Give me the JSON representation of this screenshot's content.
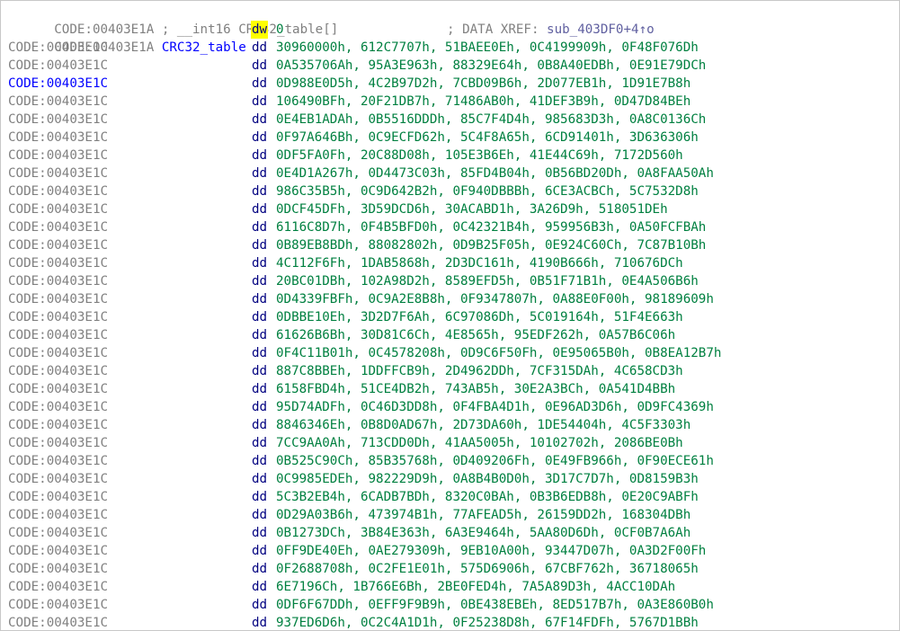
{
  "header": {
    "address": "CODE:00403E1A",
    "comment": "; __int16 CRC32_table[]"
  },
  "label_line": {
    "address": "CODE:00403E1A",
    "label": "CRC32_table",
    "mnemonic": "dw",
    "operand": "0",
    "xref_prefix": "; DATA XREF: ",
    "xref_target": "sub_403DF0+4↑o"
  },
  "rows": [
    {
      "address": "CODE:00403E1C",
      "mnemonic": "dd",
      "operands": "30960000h, 612C7707h, 51BAEE0Eh, 0C4199909h, 0F48F076Dh"
    },
    {
      "address": "CODE:00403E1C",
      "mnemonic": "dd",
      "operands": "0A535706Ah, 95A3E963h, 88329E64h, 0B8A40EDBh, 0E91E79DCh"
    },
    {
      "address": "CODE:00403E1C",
      "mnemonic": "dd",
      "operands": "0D988E0D5h, 4C2B97D2h, 7CBD09B6h, 2D077EB1h, 1D91E7B8h"
    },
    {
      "address": "CODE:00403E1C",
      "mnemonic": "dd",
      "operands": "106490BFh, 20F21DB7h, 71486AB0h, 41DEF3B9h, 0D47D84BEh"
    },
    {
      "address": "CODE:00403E1C",
      "mnemonic": "dd",
      "operands": "0E4EB1ADAh, 0B5516DDDh, 85C7F4D4h, 985683D3h, 0A8C0136Ch"
    },
    {
      "address": "CODE:00403E1C",
      "mnemonic": "dd",
      "operands": "0F97A646Bh, 0C9ECFD62h, 5C4F8A65h, 6CD91401h, 3D636306h"
    },
    {
      "address": "CODE:00403E1C",
      "mnemonic": "dd",
      "operands": "0DF5FA0Fh, 20C88D08h, 105E3B6Eh, 41E44C69h, 7172D560h"
    },
    {
      "address": "CODE:00403E1C",
      "mnemonic": "dd",
      "operands": "0E4D1A267h, 0D4473C03h, 85FD4B04h, 0B56BD20Dh, 0A8FAA50Ah"
    },
    {
      "address": "CODE:00403E1C",
      "mnemonic": "dd",
      "operands": "986C35B5h, 0C9D642B2h, 0F940DBBBh, 6CE3ACBCh, 5C7532D8h"
    },
    {
      "address": "CODE:00403E1C",
      "mnemonic": "dd",
      "operands": "0DCF45DFh, 3D59DCD6h, 30ACABD1h, 3A26D9h, 518051DEh"
    },
    {
      "address": "CODE:00403E1C",
      "mnemonic": "dd",
      "operands": "6116C8D7h, 0F4B5BFD0h, 0C42321B4h, 959956B3h, 0A50FCFBAh"
    },
    {
      "address": "CODE:00403E1C",
      "mnemonic": "dd",
      "operands": "0B89EB8BDh, 88082802h, 0D9B25F05h, 0E924C60Ch, 7C87B10Bh"
    },
    {
      "address": "CODE:00403E1C",
      "mnemonic": "dd",
      "operands": "4C112F6Fh, 1DAB5868h, 2D3DC161h, 4190B666h, 710676DCh"
    },
    {
      "address": "CODE:00403E1C",
      "mnemonic": "dd",
      "operands": "20BC01DBh, 102A98D2h, 8589EFD5h, 0B51F71B1h, 0E4A506B6h"
    },
    {
      "address": "CODE:00403E1C",
      "mnemonic": "dd",
      "operands": "0D4339FBFh, 0C9A2E8B8h, 0F9347807h, 0A88E0F00h, 98189609h"
    },
    {
      "address": "CODE:00403E1C",
      "mnemonic": "dd",
      "operands": "0DBBE10Eh, 3D2D7F6Ah, 6C97086Dh, 5C019164h, 51F4E663h"
    },
    {
      "address": "CODE:00403E1C",
      "mnemonic": "dd",
      "operands": "61626B6Bh, 30D81C6Ch, 4E8565h, 95EDF262h, 0A57B6C06h"
    },
    {
      "address": "CODE:00403E1C",
      "mnemonic": "dd",
      "operands": "0F4C11B01h, 0C4578208h, 0D9C6F50Fh, 0E95065B0h, 0B8EA12B7h"
    },
    {
      "address": "CODE:00403E1C",
      "mnemonic": "dd",
      "operands": "887C8BBEh, 1DDFFCB9h, 2D4962DDh, 7CF315DAh, 4C658CD3h"
    },
    {
      "address": "CODE:00403E1C",
      "mnemonic": "dd",
      "operands": "6158FBD4h, 51CE4DB2h, 743AB5h, 30E2A3BCh, 0A541D4BBh"
    },
    {
      "address": "CODE:00403E1C",
      "mnemonic": "dd",
      "operands": "95D74ADFh, 0C46D3DD8h, 0F4FBA4D1h, 0E96AD3D6h, 0D9FC4369h"
    },
    {
      "address": "CODE:00403E1C",
      "mnemonic": "dd",
      "operands": "8846346Eh, 0B8D0AD67h, 2D73DA60h, 1DE54404h, 4C5F3303h"
    },
    {
      "address": "CODE:00403E1C",
      "mnemonic": "dd",
      "operands": "7CC9AA0Ah, 713CDD0Dh, 41AA5005h, 10102702h, 2086BE0Bh"
    },
    {
      "address": "CODE:00403E1C",
      "mnemonic": "dd",
      "operands": "0B525C90Ch, 85B35768h, 0D409206Fh, 0E49FB966h, 0F90ECE61h"
    },
    {
      "address": "CODE:00403E1C",
      "mnemonic": "dd",
      "operands": "0C9985EDEh, 982229D9h, 0A8B4B0D0h, 3D17C7D7h, 0D8159B3h"
    },
    {
      "address": "CODE:00403E1C",
      "mnemonic": "dd",
      "operands": "5C3B2EB4h, 6CADB7BDh, 8320C0BAh, 0B3B6EDB8h, 0E20C9ABFh"
    },
    {
      "address": "CODE:00403E1C",
      "mnemonic": "dd",
      "operands": "0D29A03B6h, 473974B1h, 77AFEAD5h, 26159DD2h, 168304DBh"
    },
    {
      "address": "CODE:00403E1C",
      "mnemonic": "dd",
      "operands": "0B1273DCh, 3B84E363h, 6A3E9464h, 5AA80D6Dh, 0CF0B7A6Ah"
    },
    {
      "address": "CODE:00403E1C",
      "mnemonic": "dd",
      "operands": "0FF9DE40Eh, 0AE279309h, 9EB10A00h, 93447D07h, 0A3D2F00Fh"
    },
    {
      "address": "CODE:00403E1C",
      "mnemonic": "dd",
      "operands": "0F2688708h, 0C2FE1E01h, 575D6906h, 67CBF762h, 36718065h"
    },
    {
      "address": "CODE:00403E1C",
      "mnemonic": "dd",
      "operands": "6E7196Ch, 1B766E6Bh, 2BE0FED4h, 7A5A89D3h, 4ACC10DAh"
    },
    {
      "address": "CODE:00403E1C",
      "mnemonic": "dd",
      "operands": "0DF6F67DDh, 0EFF9F9B9h, 0BE438EBEh, 8ED517B7h, 0A3E860B0h"
    },
    {
      "address": "CODE:00403E1C",
      "mnemonic": "dd",
      "operands": "937ED6D6h, 0C2C4A1D1h, 0F25238D8h, 67F14FDFh, 5767D1BBh"
    }
  ],
  "current_row_index": 2,
  "colors": {
    "address": "#808080",
    "current_address": "#0000ff",
    "label": "#0000ff",
    "mnemonic": "#000080",
    "operand": "#008040",
    "highlight": "#ffff00",
    "background": "#ffffff"
  }
}
